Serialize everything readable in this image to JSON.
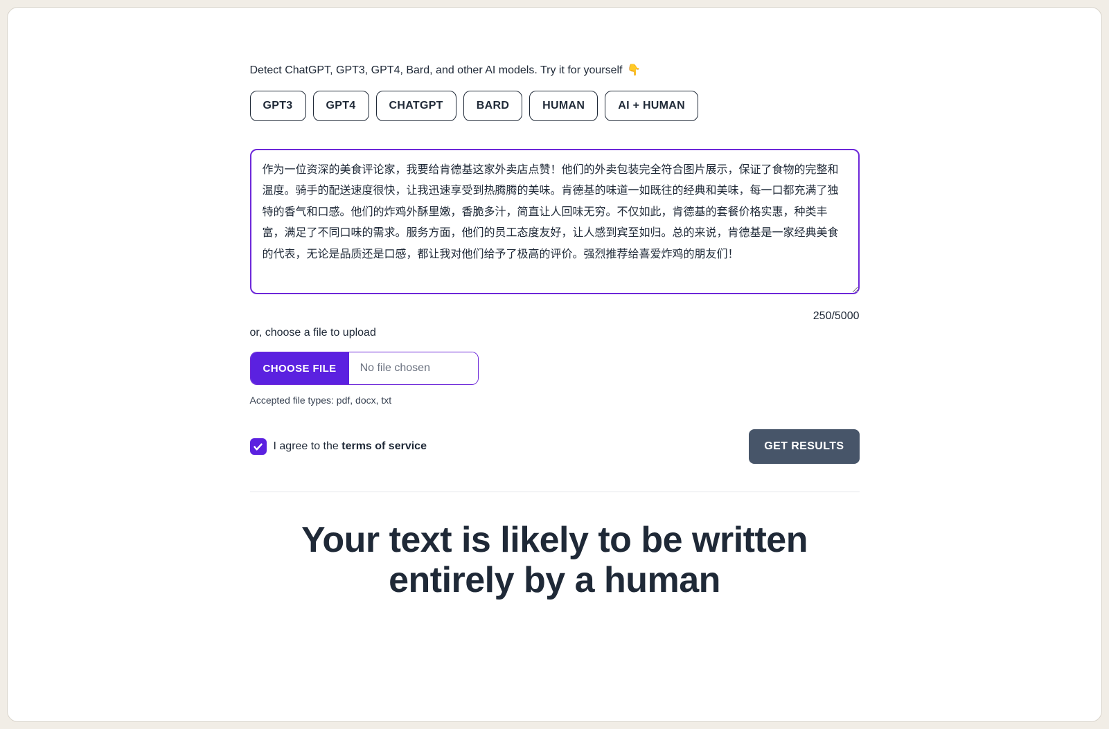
{
  "tagline": "Detect ChatGPT, GPT3, GPT4, Bard, and other AI models. Try it for yourself ",
  "tagline_emoji": "👇",
  "pills": [
    "GPT3",
    "GPT4",
    "CHATGPT",
    "BARD",
    "HUMAN",
    "AI + HUMAN"
  ],
  "textarea_value": "作为一位资深的美食评论家，我要给肯德基这家外卖店点赞！他们的外卖包装完全符合图片展示，保证了食物的完整和温度。骑手的配送速度很快，让我迅速享受到热腾腾的美味。肯德基的味道一如既往的经典和美味，每一口都充满了独特的香气和口感。他们的炸鸡外酥里嫩，香脆多汁，简直让人回味无穷。不仅如此，肯德基的套餐价格实惠，种类丰富，满足了不同口味的需求。服务方面，他们的员工态度友好，让人感到宾至如归。总的来说，肯德基是一家经典美食的代表，无论是品质还是口感，都让我对他们给予了极高的评价。强烈推荐给喜爱炸鸡的朋友们！",
  "counter": "250/5000",
  "upload_label": "or, choose a file to upload",
  "choose_file_label": "CHOOSE FILE",
  "file_name": "No file chosen",
  "accepted_types": "Accepted file types: pdf, docx, txt",
  "agree_prefix": "I agree to the ",
  "tos_label": "terms of service",
  "get_results_label": "GET RESULTS",
  "result_text": "Your text is likely to be written entirely by a human"
}
